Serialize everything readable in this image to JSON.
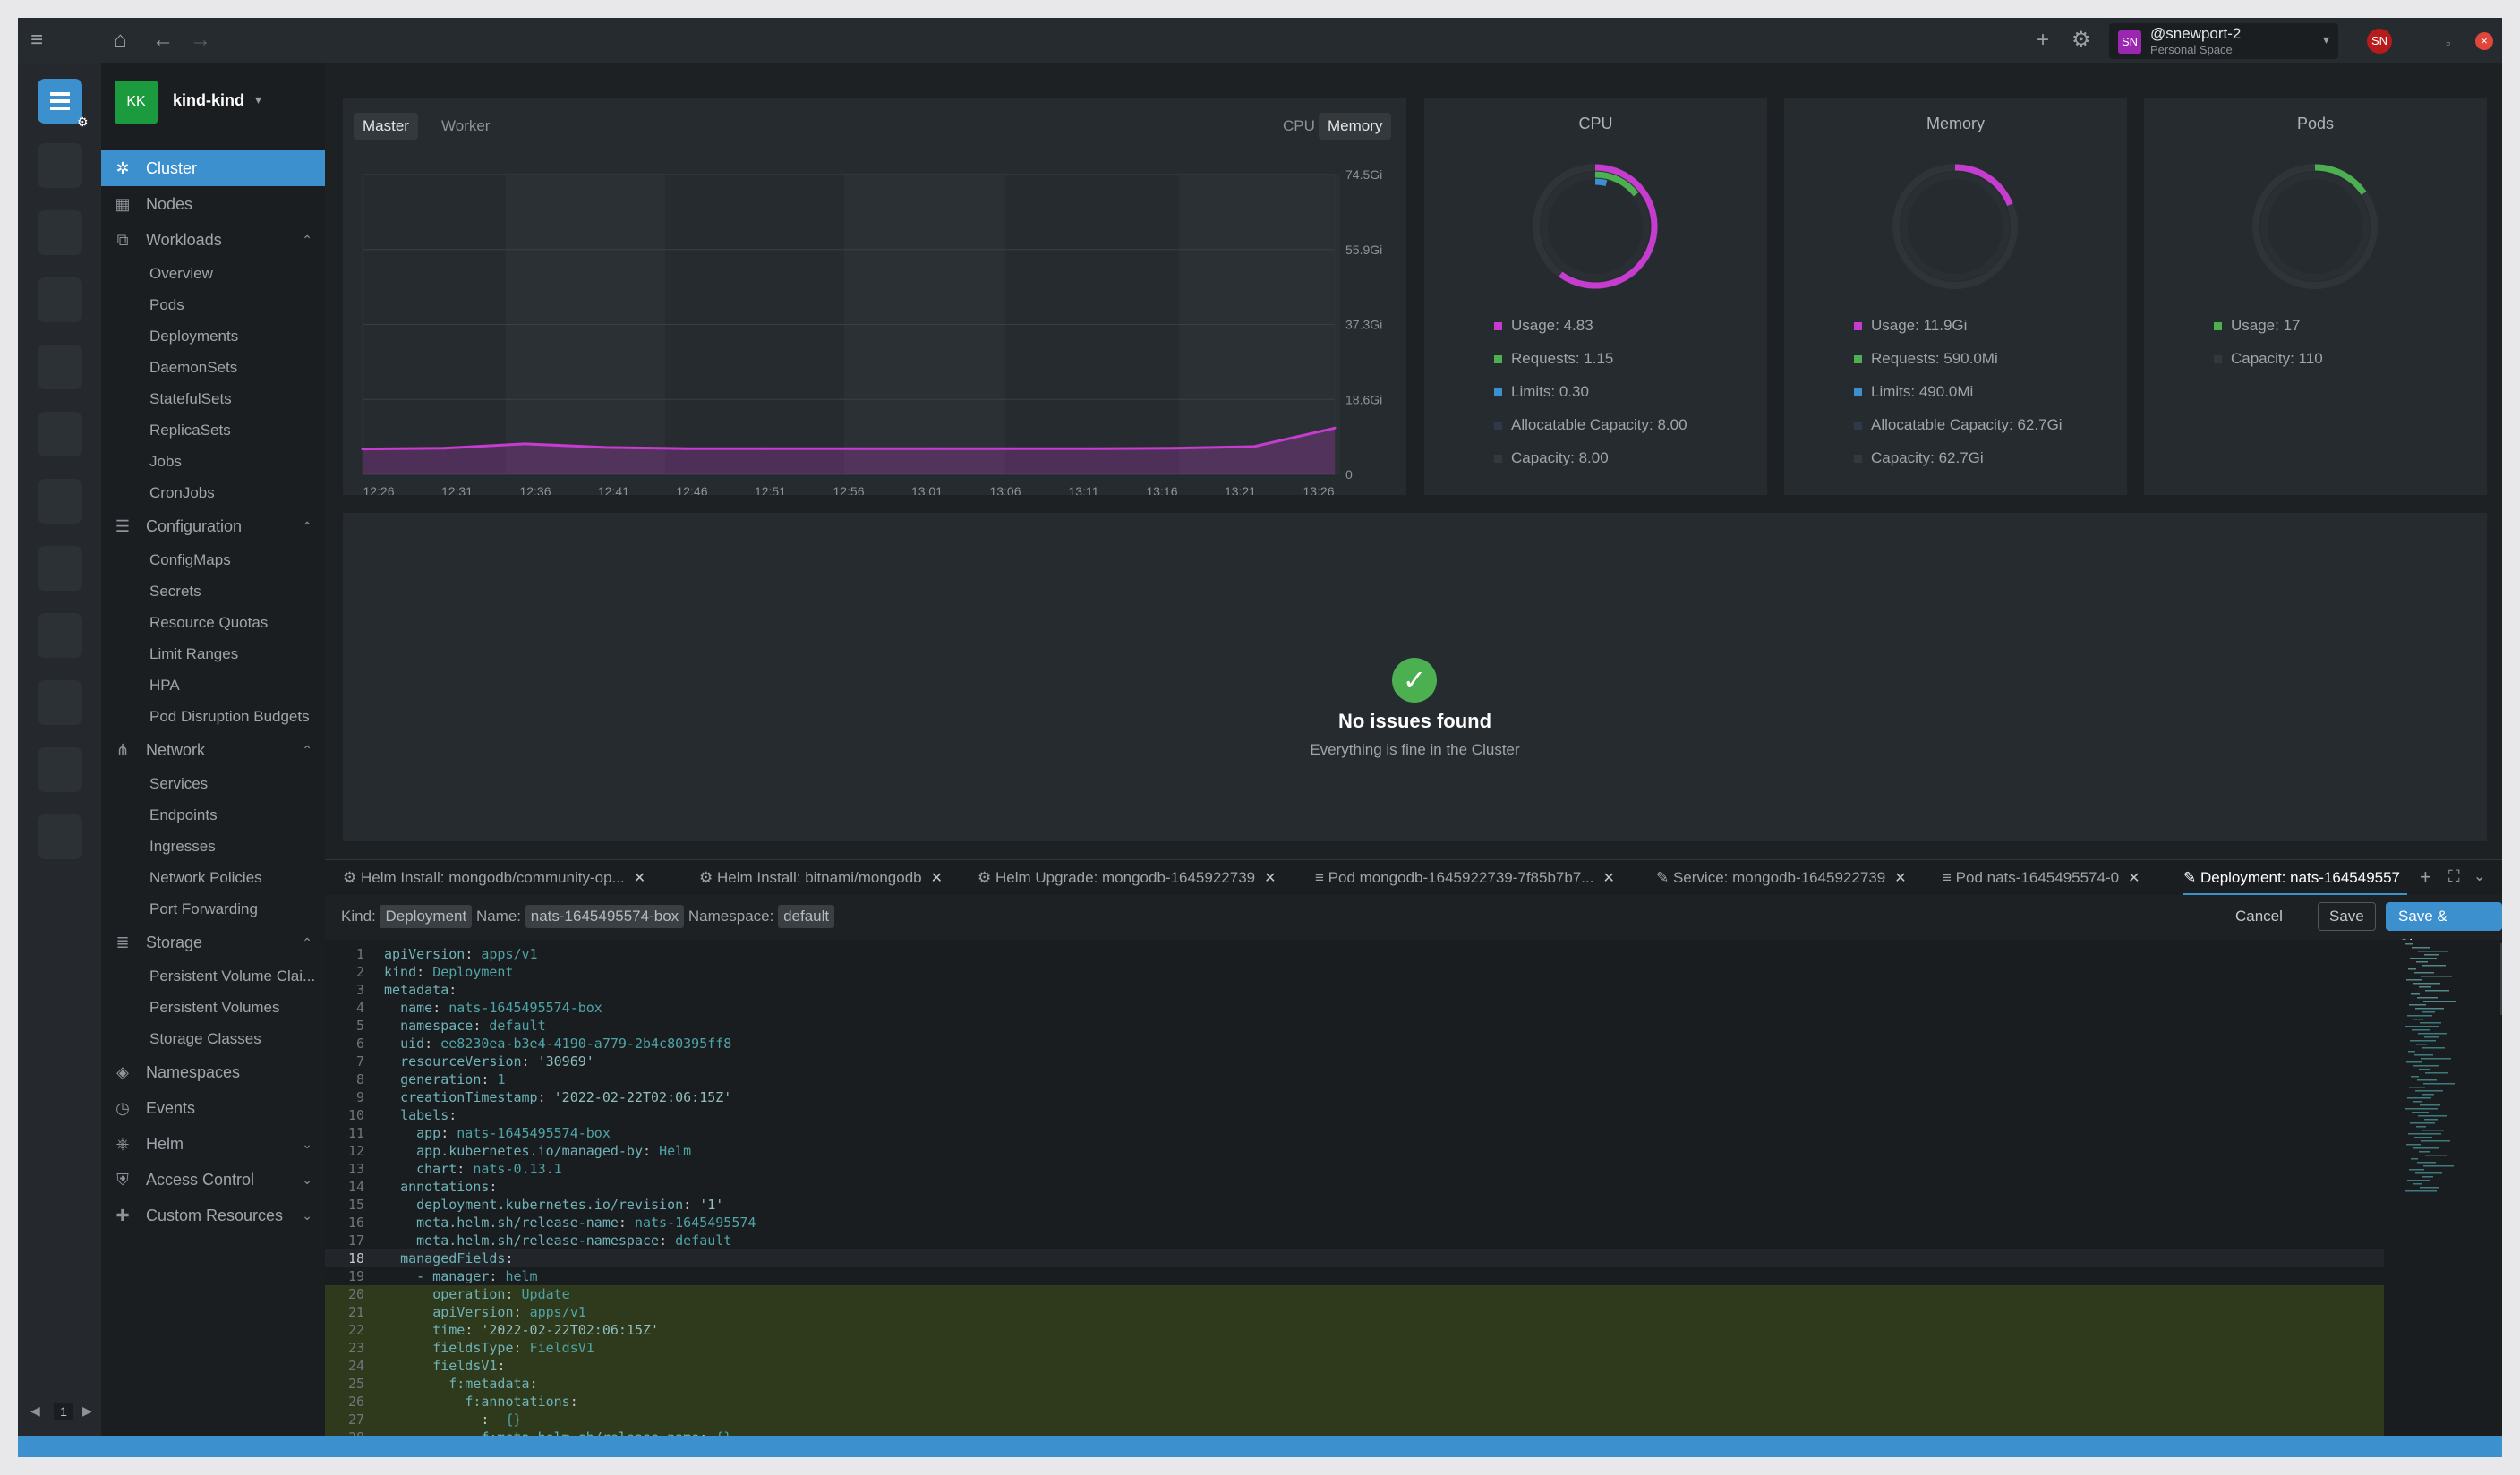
{
  "user": {
    "initials": "SN",
    "name": "@snewport-2",
    "space": "Personal Space"
  },
  "cluster": {
    "initials": "KK",
    "name": "kind-kind"
  },
  "hotbar": {
    "page": "1"
  },
  "sidebar": {
    "items": [
      {
        "label": "Cluster",
        "icon": "cluster-icon",
        "active": true
      },
      {
        "label": "Nodes",
        "icon": "nodes-icon"
      },
      {
        "label": "Workloads",
        "icon": "workloads-icon",
        "children": [
          "Overview",
          "Pods",
          "Deployments",
          "DaemonSets",
          "StatefulSets",
          "ReplicaSets",
          "Jobs",
          "CronJobs"
        ]
      },
      {
        "label": "Configuration",
        "icon": "configuration-icon",
        "children": [
          "ConfigMaps",
          "Secrets",
          "Resource Quotas",
          "Limit Ranges",
          "HPA",
          "Pod Disruption Budgets"
        ]
      },
      {
        "label": "Network",
        "icon": "network-icon",
        "children": [
          "Services",
          "Endpoints",
          "Ingresses",
          "Network Policies",
          "Port Forwarding"
        ]
      },
      {
        "label": "Storage",
        "icon": "storage-icon",
        "children": [
          "Persistent Volume Clai...",
          "Persistent Volumes",
          "Storage Classes"
        ]
      },
      {
        "label": "Namespaces",
        "icon": "namespaces-icon"
      },
      {
        "label": "Events",
        "icon": "events-icon"
      },
      {
        "label": "Helm",
        "icon": "helm-icon",
        "collapsed": true
      },
      {
        "label": "Access Control",
        "icon": "access-control-icon",
        "collapsed": true
      },
      {
        "label": "Custom Resources",
        "icon": "custom-resources-icon",
        "collapsed": true
      }
    ]
  },
  "metrics": {
    "node_tabs": [
      "Master",
      "Worker"
    ],
    "active_node_tab": "Master",
    "metric_tabs": [
      "CPU",
      "Memory"
    ],
    "active_metric_tab": "Memory"
  },
  "chart_data": {
    "type": "area",
    "x": [
      "12:26",
      "12:31",
      "12:36",
      "12:41",
      "12:46",
      "12:51",
      "12:56",
      "13:01",
      "13:06",
      "13:11",
      "13:16",
      "13:21",
      "13:26"
    ],
    "yticks": [
      "74.5Gi",
      "55.9Gi",
      "37.3Gi",
      "18.6Gi",
      "0"
    ],
    "ylim": [
      0,
      74.5
    ],
    "series": [
      {
        "values": [
          6.3,
          6.5,
          7.6,
          6.7,
          6.4,
          6.4,
          6.4,
          6.4,
          6.4,
          6.4,
          6.5,
          6.9,
          11.5
        ],
        "color": "#c63ccf"
      }
    ],
    "grid": true
  },
  "donuts": [
    {
      "title": "CPU",
      "legend": [
        {
          "text": "Usage: 4.83",
          "color": "#c63ccf"
        },
        {
          "text": "Requests: 1.15",
          "color": "#4caf50"
        },
        {
          "text": "Limits: 0.30",
          "color": "#3d90ce"
        },
        {
          "text": "Allocatable Capacity: 8.00",
          "color": "#2e3a4a"
        },
        {
          "text": "Capacity: 8.00",
          "color": "#33383d"
        }
      ],
      "ring_fractions": {
        "usage": 0.6,
        "requests": 0.144,
        "limits": 0.04
      }
    },
    {
      "title": "Memory",
      "legend": [
        {
          "text": "Usage: 11.9Gi",
          "color": "#c63ccf"
        },
        {
          "text": "Requests: 590.0Mi",
          "color": "#4caf50"
        },
        {
          "text": "Limits: 490.0Mi",
          "color": "#3d90ce"
        },
        {
          "text": "Allocatable Capacity: 62.7Gi",
          "color": "#2e3a4a"
        },
        {
          "text": "Capacity: 62.7Gi",
          "color": "#33383d"
        }
      ],
      "ring_fractions": {
        "usage": 0.19
      }
    },
    {
      "title": "Pods",
      "legend": [
        {
          "text": "Usage: 17",
          "color": "#4caf50"
        },
        {
          "text": "Capacity: 110",
          "color": "#33383d"
        }
      ],
      "ring_fractions": {
        "usage": 0.155
      }
    }
  ],
  "issues": {
    "title": "No issues found",
    "subtitle": "Everything is fine in the Cluster"
  },
  "dock": {
    "tabs": [
      {
        "label": "Helm Install: mongodb/community-op...",
        "icon": "helm-icon"
      },
      {
        "label": "Helm Install: bitnami/mongodb",
        "icon": "helm-icon"
      },
      {
        "label": "Helm Upgrade: mongodb-1645922739",
        "icon": "helm-icon"
      },
      {
        "label": "Pod mongodb-1645922739-7f85b7b7...",
        "icon": "logs-icon"
      },
      {
        "label": "Service: mongodb-1645922739",
        "icon": "edit-icon"
      },
      {
        "label": "Pod nats-1645495574-0",
        "icon": "logs-icon"
      },
      {
        "label": "Deployment: nats-164549557",
        "icon": "edit-icon",
        "active": true
      }
    ],
    "kind_label": "Kind:",
    "kind": "Deployment",
    "name_label": "Name:",
    "name": "nats-1645495574-box",
    "ns_label": "Namespace:",
    "namespace": "default",
    "cancel": "Cancel",
    "save": "Save",
    "save_close": "Save & Close"
  },
  "editor": {
    "lines": [
      {
        "k": "apiVersion",
        "v": "apps/v1",
        "indent": 0
      },
      {
        "k": "kind",
        "v": "Deployment",
        "indent": 0
      },
      {
        "k": "metadata",
        "v": "",
        "indent": 0
      },
      {
        "k": "name",
        "v": "nats-1645495574-box",
        "indent": 2
      },
      {
        "k": "namespace",
        "v": "default",
        "indent": 2
      },
      {
        "k": "uid",
        "v": "ee8230ea-b3e4-4190-a779-2b4c80395ff8",
        "indent": 2
      },
      {
        "k": "resourceVersion",
        "v": "'30969'",
        "indent": 2
      },
      {
        "k": "generation",
        "v": "1",
        "indent": 2
      },
      {
        "k": "creationTimestamp",
        "v": "'2022-02-22T02:06:15Z'",
        "indent": 2
      },
      {
        "k": "labels",
        "v": "",
        "indent": 2
      },
      {
        "k": "app",
        "v": "nats-1645495574-box",
        "indent": 4
      },
      {
        "k": "app.kubernetes.io/managed-by",
        "v": "Helm",
        "indent": 4
      },
      {
        "k": "chart",
        "v": "nats-0.13.1",
        "indent": 4
      },
      {
        "k": "annotations",
        "v": "",
        "indent": 2
      },
      {
        "k": "deployment.kubernetes.io/revision",
        "v": "'1'",
        "indent": 4
      },
      {
        "k": "meta.helm.sh/release-name",
        "v": "nats-1645495574",
        "indent": 4
      },
      {
        "k": "meta.helm.sh/release-namespace",
        "v": "default",
        "indent": 4
      },
      {
        "k": "managedFields",
        "v": "",
        "indent": 2
      },
      {
        "k": "- manager",
        "v": "helm",
        "indent": 4
      },
      {
        "k": "operation",
        "v": "Update",
        "indent": 6
      },
      {
        "k": "apiVersion",
        "v": "apps/v1",
        "indent": 6
      },
      {
        "k": "time",
        "v": "'2022-02-22T02:06:15Z'",
        "indent": 6
      },
      {
        "k": "fieldsType",
        "v": "FieldsV1",
        "indent": 6
      },
      {
        "k": "fieldsV1",
        "v": "",
        "indent": 6
      },
      {
        "k": "f:metadata",
        "v": "",
        "indent": 8
      },
      {
        "k": "f:annotations",
        "v": "",
        "indent": 10
      },
      {
        "k": "",
        "v": "{}",
        "indent": 12
      },
      {
        "k": "f:meta.helm.sh/release-name",
        "v": "{}",
        "indent": 12
      }
    ],
    "highlight_from": 20,
    "cursor_line": 18
  }
}
